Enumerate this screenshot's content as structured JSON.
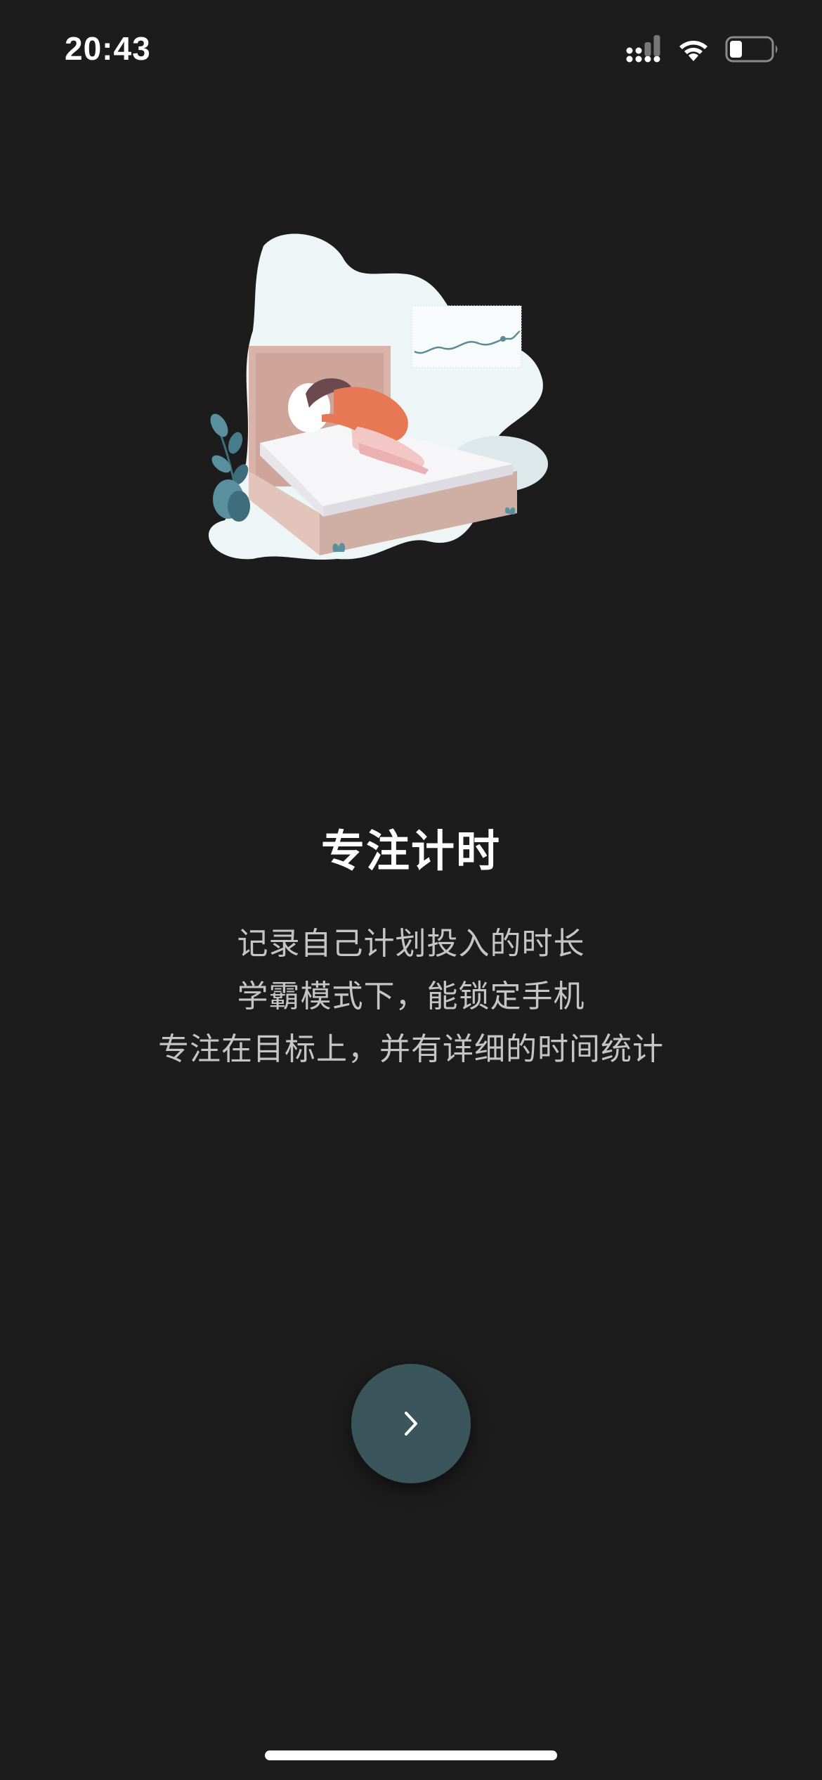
{
  "status_bar": {
    "time": "20:43",
    "icons": [
      "cellular-signal-icon",
      "wifi-icon",
      "battery-icon"
    ],
    "battery_level": 0.25
  },
  "illustration": {
    "subject": "woman-sleeping-on-bed-illustration"
  },
  "intro": {
    "title": "专注计时",
    "lines": [
      "记录自己计划投入的时长",
      "学霸模式下，能锁定手机",
      "专注在目标上，并有详细的时间统计"
    ]
  },
  "next_button": {
    "icon": "chevron-right-icon",
    "color": "#3b555d"
  },
  "colors": {
    "background": "#1c1c1c",
    "accent": "#3b555d",
    "text_primary": "#ffffff",
    "text_secondary": "#c5c5c5"
  }
}
